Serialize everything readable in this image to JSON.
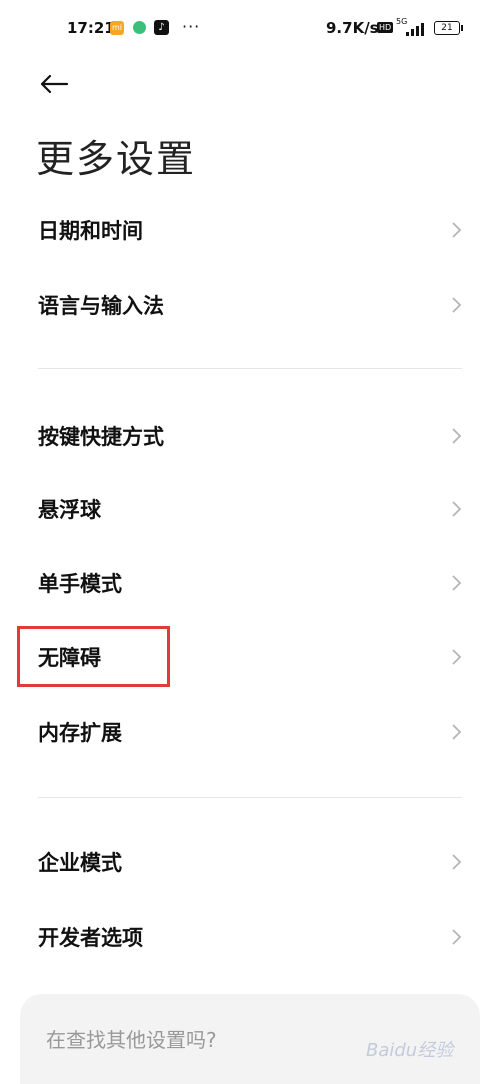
{
  "status_bar": {
    "time": "17:21",
    "app_mi": "mi",
    "app_tiktok": "♪",
    "dots": "···",
    "speed": "9.7K/s",
    "hd": "HD",
    "network": "5G",
    "battery": "21"
  },
  "header": {
    "back_icon": "arrow-left-icon",
    "title": "更多设置"
  },
  "sections": [
    {
      "items": [
        {
          "label": "日期和时间"
        },
        {
          "label": "语言与输入法"
        }
      ]
    },
    {
      "items": [
        {
          "label": "按键快捷方式"
        },
        {
          "label": "悬浮球"
        },
        {
          "label": "单手模式"
        },
        {
          "label": "无障碍",
          "highlighted": true
        },
        {
          "label": "内存扩展"
        }
      ]
    },
    {
      "items": [
        {
          "label": "企业模式"
        },
        {
          "label": "开发者选项"
        }
      ]
    }
  ],
  "search_card": {
    "text": "在查找其他设置吗?"
  },
  "watermark": "Baidu经验",
  "colors": {
    "highlight": "#e03a3a",
    "divider": "#e6e6e6",
    "card_bg": "#f3f3f3"
  }
}
